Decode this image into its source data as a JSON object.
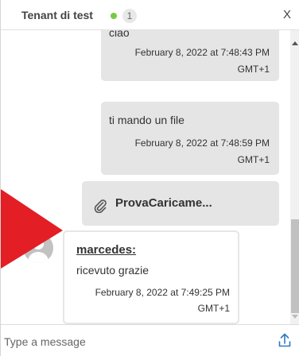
{
  "header": {
    "title": "Tenant di test",
    "count": "1",
    "close_label": "X"
  },
  "messages": [
    {
      "direction": "out",
      "text": "ciao",
      "time_line1": "February 8, 2022 at 7:48:43 PM",
      "time_line2": "GMT+1"
    },
    {
      "direction": "out",
      "text": "ti mando un file",
      "time_line1": "February 8, 2022 at 7:48:59 PM",
      "time_line2": "GMT+1"
    },
    {
      "direction": "out",
      "type": "file",
      "file_name": "ProvaCaricame...",
      "icon": "paperclip-icon"
    },
    {
      "direction": "in",
      "sender": "marcedes:",
      "text": "ricevuto grazie",
      "time_line1": "February 8, 2022 at 7:49:25 PM",
      "time_line2": "GMT+1"
    }
  ],
  "composer": {
    "placeholder": "Type a message",
    "upload_icon": "upload-icon"
  },
  "colors": {
    "online_status": "#7ac943",
    "outgoing_bubble": "#e5e5e5",
    "pointer_arrow": "#e31e24",
    "upload_accent": "#2f78c4"
  }
}
